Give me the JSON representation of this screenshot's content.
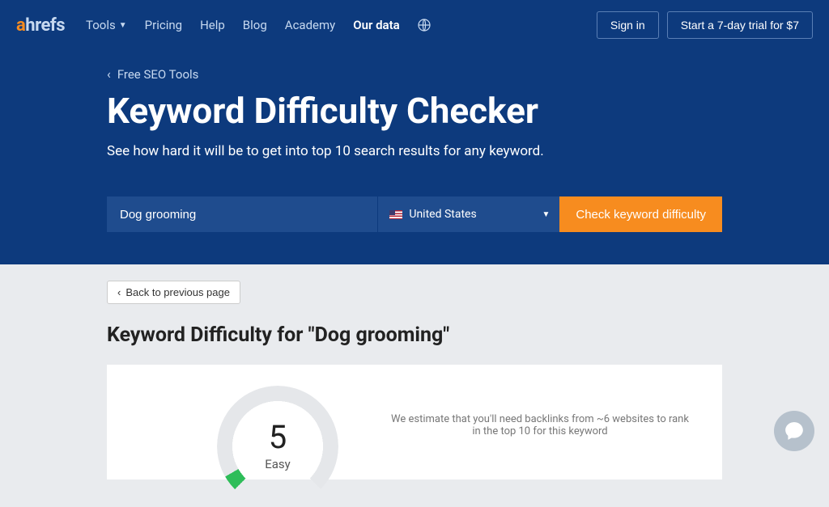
{
  "nav": {
    "logo": {
      "a": "a",
      "rest": "hrefs"
    },
    "links": [
      "Tools",
      "Pricing",
      "Help",
      "Blog",
      "Academy",
      "Our data"
    ],
    "active_index": 5,
    "sign_in": "Sign in",
    "trial": "Start a 7-day trial for $7"
  },
  "hero": {
    "breadcrumb": "Free SEO Tools",
    "title": "Keyword Difficulty Checker",
    "subtitle": "See how hard it will be to get into top 10 search results for any keyword."
  },
  "search": {
    "keyword": "Dog grooming",
    "country": "United States",
    "button": "Check keyword difficulty"
  },
  "result": {
    "back": "Back to previous page",
    "title_prefix": "Keyword Difficulty for ",
    "title_keyword": "\"Dog grooming\"",
    "score": "5",
    "label": "Easy",
    "estimate": "We estimate that you'll need backlinks from ~6 websites to rank in the top 10 for this keyword"
  }
}
